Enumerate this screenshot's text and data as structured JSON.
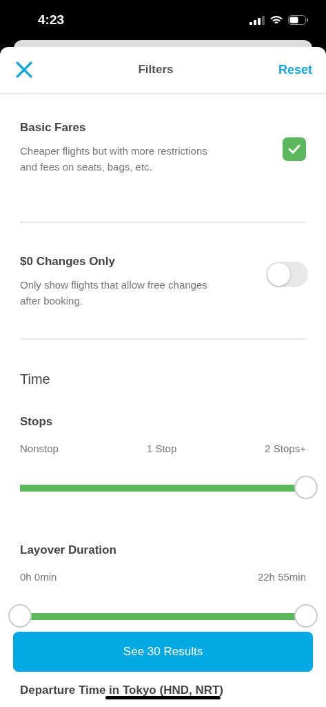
{
  "status_bar": {
    "time": "4:23"
  },
  "header": {
    "title": "Filters",
    "reset": "Reset"
  },
  "options": [
    {
      "kind": "checkbox",
      "title": "Basic Fares",
      "description": "Cheaper flights but with more restrictions and fees on seats, bags, etc.",
      "checked": true
    },
    {
      "kind": "toggle",
      "title": "$0 Changes Only",
      "description": "Only show flights that allow free changes after booking.",
      "on": false
    }
  ],
  "section_title": "Time",
  "sliders": [
    {
      "title": "Stops",
      "labels": [
        "Nonstop",
        "1 Stop",
        "2 Stops+"
      ],
      "thumbs": [
        {
          "level": 1
        }
      ]
    },
    {
      "title": "Layover Duration",
      "labels": [
        "0h 0min",
        "22h 55min"
      ],
      "thumbs": [
        {
          "level": 0
        },
        {
          "level": 1
        }
      ]
    }
  ],
  "next_title": "Departure Time in Tokyo (HND, NRT)",
  "results_button": "See 30 Results"
}
